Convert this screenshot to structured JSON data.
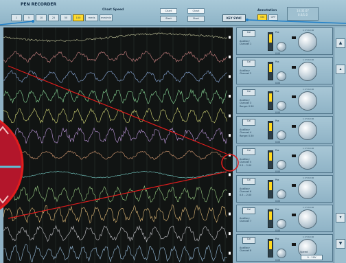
{
  "title": "PEN RECORDER",
  "chart_speed": {
    "label": "Chart Speed",
    "buttons": [
      {
        "label": "1"
      },
      {
        "label": "5"
      },
      {
        "label": "10"
      },
      {
        "label": "25"
      },
      {
        "label": "50"
      },
      {
        "label": "100",
        "active": true
      },
      {
        "label": "mm/s"
      },
      {
        "label": "mm/min"
      }
    ]
  },
  "chart_groups": [
    {
      "label": "Chart",
      "button": "Start"
    },
    {
      "label": "Chart",
      "button": "Start"
    }
  ],
  "key_sync_label": "KEY SYNC",
  "annotation": {
    "label": "Annotation",
    "on": "ON",
    "off": "OFF"
  },
  "readout": {
    "line1": "14:32:07",
    "line2": "0.0/1.0"
  },
  "channels": [
    {
      "button": "Cal",
      "line1": "Auxiliary",
      "line2": "Channel 1",
      "line3": ""
    },
    {
      "button": "Cal",
      "line1": "Auxiliary",
      "line2": "Channel 2",
      "line3": ""
    },
    {
      "button": "Cal",
      "line1": "Auxiliary",
      "line2": "Channel 3",
      "line3": "Range: 0.50"
    },
    {
      "button": "Cal",
      "line1": "Auxiliary",
      "line2": "Channel 4",
      "line3": "Range: 0.50"
    },
    {
      "button": "Cal",
      "line1": "Auxiliary",
      "line2": "Channel 5",
      "line3": "0.5 .. 2.00"
    },
    {
      "button": "Cal",
      "line1": "Auxiliary",
      "line2": "Channel 6",
      "line3": "0.5 .. 2.00"
    },
    {
      "button": "Cal",
      "line1": "Auxiliary",
      "line2": "Channel 7",
      "line3": ""
    },
    {
      "button": "Cal",
      "line1": "Auxiliary",
      "line2": "Channel 8",
      "line3": ""
    }
  ],
  "channel_controls": {
    "pos_label": "Pos",
    "knob_label": "Pos",
    "knob_value": "0.00",
    "scale_ticks": "1  2  5  10  20"
  },
  "speed_label": "Speed",
  "speed_value": "0 - 10V",
  "scroll": {
    "up": "▲",
    "up_small": "▴",
    "down_small": "▾",
    "down": "▼"
  },
  "colors": {
    "panel": "#8fb1c4",
    "chart_bg": "#111413",
    "accent_yellow": "#ffdb2e",
    "callout_red": "#e01d1d",
    "callout_blue": "#1f7fc8"
  },
  "traces": [
    {
      "color": "#cfd1a5",
      "amp": 0.3,
      "freq": 0.02,
      "noise": 0.2
    },
    {
      "color": "#d98b8b",
      "amp": 0.35,
      "freq": 0.2,
      "noise": 0.4
    },
    {
      "color": "#93b4e8",
      "amp": 0.4,
      "freq": 0.22,
      "noise": 0.3
    },
    {
      "color": "#8ee09e",
      "amp": 0.45,
      "freq": 0.35,
      "noise": 0.5
    },
    {
      "color": "#dde07c",
      "amp": 0.5,
      "freq": 0.3,
      "noise": 0.4
    },
    {
      "color": "#c8a0e8",
      "amp": 0.45,
      "freq": 0.28,
      "noise": 0.6
    },
    {
      "color": "#e0a278",
      "amp": 0.3,
      "freq": 0.18,
      "noise": 0.2
    },
    {
      "color": "#7ed7d0",
      "amp": 0.25,
      "freq": 0.05,
      "noise": 0.1
    },
    {
      "color": "#9fd38a",
      "amp": 0.5,
      "freq": 0.32,
      "noise": 0.5
    },
    {
      "color": "#e9c17d",
      "amp": 0.55,
      "freq": 0.34,
      "noise": 0.6
    },
    {
      "color": "#cfcfd5",
      "amp": 0.5,
      "freq": 0.26,
      "noise": 0.5
    },
    {
      "color": "#9ec3e3",
      "amp": 0.55,
      "freq": 0.38,
      "noise": 0.6
    }
  ]
}
